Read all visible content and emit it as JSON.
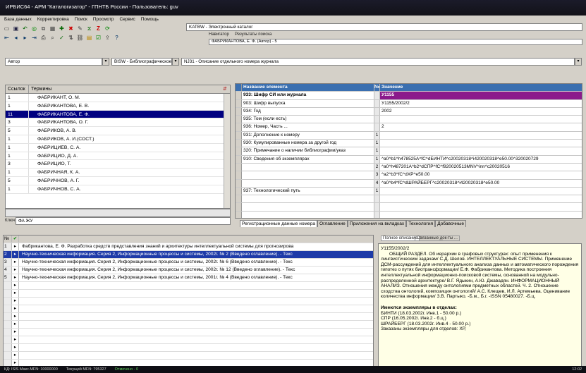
{
  "window": {
    "title": "ИРБИС64 - АРМ \"Каталогизатор\" - ГПНТБ России - Пользователь: guv"
  },
  "menu": [
    "База данных",
    "Корректировка",
    "Поиск",
    "Просмотр",
    "Сервис",
    "Помощь"
  ],
  "db_field": "KATBW - Электронный каталог",
  "top_tabs": [
    "Навигатор",
    "Результаты поиска"
  ],
  "nav_field": "ФАБРИКАНТОВА, Е. Ф. (Автор) - 5",
  "search_prefix": "Автор",
  "worksheet": "BISW - Библиографическое",
  "worksheet_desc": "NJ31 - Описание отдельного номера журнала",
  "dict": {
    "head_count": "Ссылок",
    "head_terms": "Термины",
    "rows": [
      {
        "c": "1",
        "t": "ФАБРИКАНТ, О. М."
      },
      {
        "c": "1",
        "t": "ФАБРИКАНТОВА, Е. В."
      },
      {
        "c": "11",
        "t": "ФАБРИКАНТОВА, Е. Ф.",
        "sel": true
      },
      {
        "c": "3",
        "t": "ФАБРИКАНТОВА, О. Г."
      },
      {
        "c": "5",
        "t": "ФАБРИКОВ, А. В."
      },
      {
        "c": "1",
        "t": "ФАБРИКОВ, А. И.(СОСТ.)"
      },
      {
        "c": "1",
        "t": "ФАБРИЦИЕВ, С. А."
      },
      {
        "c": "1",
        "t": "ФАБРИЦИО, Д. А."
      },
      {
        "c": "3",
        "t": "ФАБРИЦИО, Т."
      },
      {
        "c": "1",
        "t": "ФАБРИЧНАЯ, К. А."
      },
      {
        "c": "5",
        "t": "ФАБРИЧНОВ, А. Г."
      },
      {
        "c": "1",
        "t": "ФАБРИЧНОВ, С. А."
      }
    ]
  },
  "key_label": "Ключ",
  "key_value": "ФА ЖУ",
  "fields": {
    "head_name": "Название элемента",
    "head_n": "№",
    "head_value": "Значение",
    "rows": [
      {
        "n": "933: Шифр СИ или журнала",
        "i": "",
        "v": "У1155",
        "bold": true,
        "purple": true
      },
      {
        "n": "903: Шифр выпуска",
        "i": "",
        "v": "У1155/2002/2"
      },
      {
        "n": "934: Год",
        "i": "",
        "v": "2002"
      },
      {
        "n": "935: Том (если есть)",
        "i": "",
        "v": ""
      },
      {
        "n": "936: Номер, Часть ...",
        "i": "",
        "v": "2"
      },
      {
        "n": "931: Дополнение к номеру",
        "i": "1",
        "v": ""
      },
      {
        "n": "930: Кумулированные номера за другой год",
        "i": "1",
        "v": ""
      },
      {
        "n": "320: Примечание о наличии библиографии/указ",
        "i": "1",
        "v": ""
      },
      {
        "n": "910: Сведения об экземплярах",
        "i": "1",
        "v": "^a0^b1^h478525A^fC^dБИНТИ^c20020318^i420020318^e50.00^320020729"
      },
      {
        "n": "",
        "i": "2",
        "v": "^a0^h487201A^b2^dСПР^fC^f920020513MNV^inn^c20020516"
      },
      {
        "n": "",
        "i": "3",
        "v": "^a2^b3^fC^dXP^e50.00"
      },
      {
        "n": "",
        "i": "4",
        "v": "^a0^b4^fC^dШРАЙБЕРГ^c20020318^i420020318^e50.00"
      },
      {
        "n": "937: Технологический путь",
        "i": "1",
        "v": ""
      }
    ]
  },
  "tabs": [
    "Регистрационные данные номера",
    "Оглавление",
    "Приложения на вкладках",
    "Технология",
    "Добавочные"
  ],
  "list": {
    "head_n": "№",
    "head_check": "✔",
    "rows": [
      {
        "n": "1",
        "t": "Фабрикантова, Е. Ф. Разработка средств представления знаний и архитектуры интеллектуальной системы для прогнозирова"
      },
      {
        "n": "2",
        "t": "Научно-техническая информация. Серия 2, Информационные процессы и системы, 2002г. № 2 (Введено оглавление). - Текс",
        "sel": true
      },
      {
        "n": "3",
        "t": "Научно-техническая информация. Серия 2, Информационные процессы и системы, 2002г. № 6 (Введено оглавление). - Текс"
      },
      {
        "n": "4",
        "t": "Научно-техническая информация. Серия 2, Информационные процессы и системы, 2002г. № 12 (Введено оглавление). - Текс"
      },
      {
        "n": "5",
        "t": "Научно-техническая информация. Серия 2, Информационные процессы и системы, 2001г. № 4 (Введено оглавление). - Текс"
      }
    ],
    "empty_rows": 12
  },
  "desc_tabs": [
    "Полное описание",
    "Связанные док-ты ..."
  ],
  "desc": {
    "code": "У1155/2002/2",
    "body": "ОБЩИЙ РАЗДЕЛ. Об иерархии в графовых структурах: опыт применения к лингвистическим задачам/ С.Д. Шелов. ИНТЕЛЛЕКТУАЛЬНЫЕ СИСТЕМЫ. Применение ДСМ-рассуждений для интеллектуального анализа данных и автоматического порождения гипотез о путях биотрансформации/ Е.Ф. Фабрикантова. Методика построения интеллектуальной информационно-поисковой системы, основанной на модульно-распределенной архитектуре/ В.Г. Ядыкин, А.Ю. Джавадян. ИНФОРМАЦИОННЫЙ АНАЛИЗ. Отношения между онтологиями предметных областей. Ч. 2. Отношение сходства онтологий, композиция онтологий/ А.С. Клещев, И.Л. Артемьева. Оценивание количества информации/ З.В. Партыко. -Б.м., Б.г. -ISSN 05480027. -Б.ц.",
    "holdings_title": "Имеются экземпляры в отделах:",
    "holdings": [
      "БИНТИ (18.03.2002г. Инв.1 - 50.00 р.)",
      "СПР (16.05.2002г. Инв.2 - б.ц.)",
      "ШРАЙБЕРГ (18.03.2002г. Инв.4 - 50.00 р.)",
      "Заказаны экземпляры для отделов: ХР,"
    ]
  },
  "status": {
    "s1": "КД: ISIS Макс.MFN: 10000000",
    "s2": "Текущий MFN: 795327",
    "s3": "Отмечено - 0",
    "time": "12:02"
  }
}
